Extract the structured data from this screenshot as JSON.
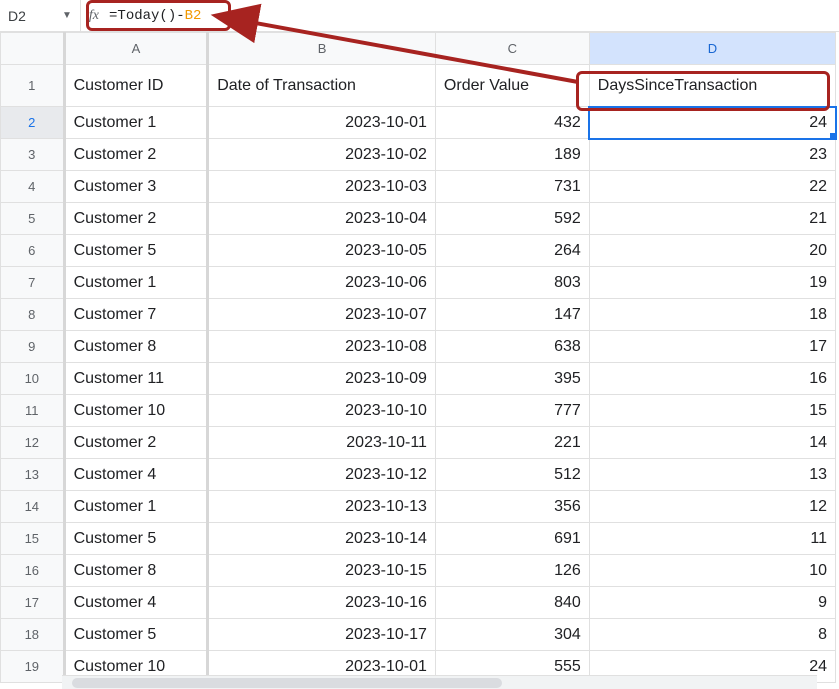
{
  "name_box": "D2",
  "formula_display": "=Today()-",
  "formula_ref": "B2",
  "columns": [
    "A",
    "B",
    "C",
    "D"
  ],
  "headers": {
    "A": "Customer ID",
    "B": "Date of Transaction",
    "C": "Order Value",
    "D": "DaysSinceTransaction"
  },
  "active_cell": {
    "row": 2,
    "col": "D"
  },
  "rows": [
    {
      "n": 2,
      "A": "Customer 1",
      "B": "2023-10-01",
      "C": "432",
      "D": "24"
    },
    {
      "n": 3,
      "A": "Customer 2",
      "B": "2023-10-02",
      "C": "189",
      "D": "23"
    },
    {
      "n": 4,
      "A": "Customer 3",
      "B": "2023-10-03",
      "C": "731",
      "D": "22"
    },
    {
      "n": 5,
      "A": "Customer 2",
      "B": "2023-10-04",
      "C": "592",
      "D": "21"
    },
    {
      "n": 6,
      "A": "Customer 5",
      "B": "2023-10-05",
      "C": "264",
      "D": "20"
    },
    {
      "n": 7,
      "A": "Customer 1",
      "B": "2023-10-06",
      "C": "803",
      "D": "19"
    },
    {
      "n": 8,
      "A": "Customer 7",
      "B": "2023-10-07",
      "C": "147",
      "D": "18"
    },
    {
      "n": 9,
      "A": "Customer 8",
      "B": "2023-10-08",
      "C": "638",
      "D": "17"
    },
    {
      "n": 10,
      "A": "Customer 11",
      "B": "2023-10-09",
      "C": "395",
      "D": "16"
    },
    {
      "n": 11,
      "A": "Customer 10",
      "B": "2023-10-10",
      "C": "777",
      "D": "15"
    },
    {
      "n": 12,
      "A": "Customer 2",
      "B": "2023-10-11",
      "C": "221",
      "D": "14"
    },
    {
      "n": 13,
      "A": "Customer 4",
      "B": "2023-10-12",
      "C": "512",
      "D": "13"
    },
    {
      "n": 14,
      "A": "Customer 1",
      "B": "2023-10-13",
      "C": "356",
      "D": "12"
    },
    {
      "n": 15,
      "A": "Customer 5",
      "B": "2023-10-14",
      "C": "691",
      "D": "11"
    },
    {
      "n": 16,
      "A": "Customer 8",
      "B": "2023-10-15",
      "C": "126",
      "D": "10"
    },
    {
      "n": 17,
      "A": "Customer 4",
      "B": "2023-10-16",
      "C": "840",
      "D": "9"
    },
    {
      "n": 18,
      "A": "Customer 5",
      "B": "2023-10-17",
      "C": "304",
      "D": "8"
    },
    {
      "n": 19,
      "A": "Customer 10",
      "B": "2023-10-01",
      "C": "555",
      "D": "24"
    }
  ]
}
